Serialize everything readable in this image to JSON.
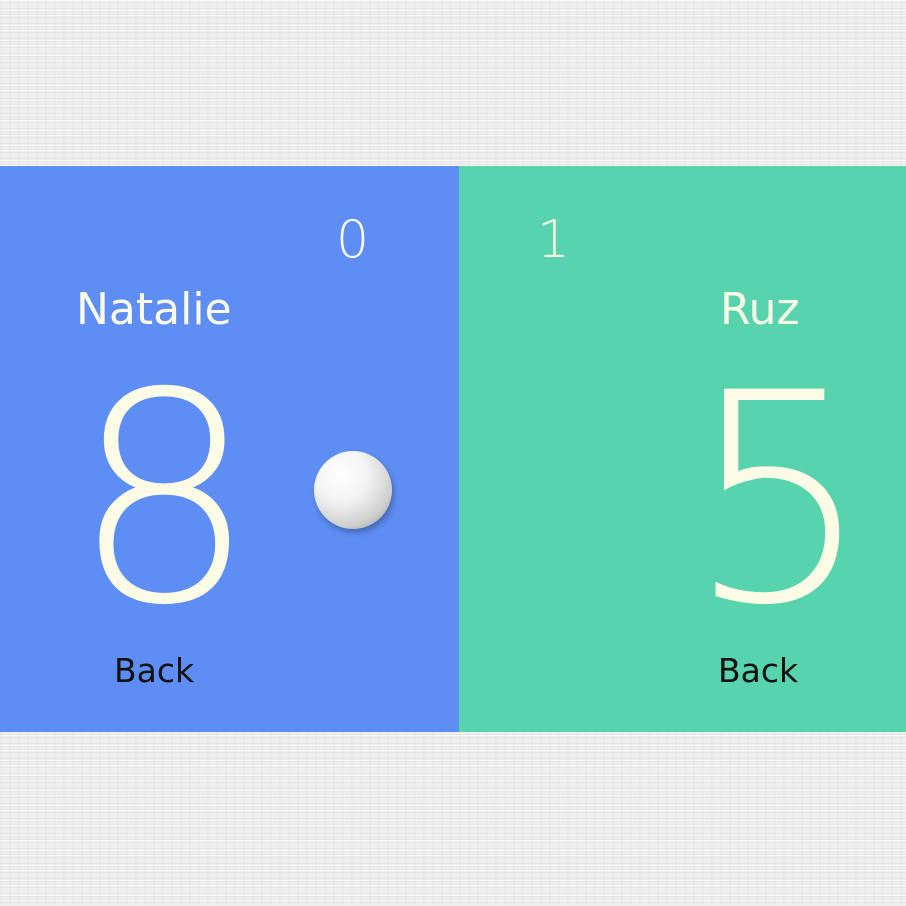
{
  "left_player": {
    "name": "Natalie",
    "games": "0",
    "points": "8",
    "back_label": "Back",
    "color": "#5e8ef3"
  },
  "right_player": {
    "name": "Ruz",
    "games": "1",
    "points": "5",
    "back_label": "Back",
    "color": "#57d3ad"
  },
  "serve_indicator": {
    "icon": "ping-pong-ball-icon",
    "side": "left"
  },
  "colors": {
    "text_light": "#fbfbe6",
    "text_dark": "#111111",
    "background": "#efefef"
  }
}
